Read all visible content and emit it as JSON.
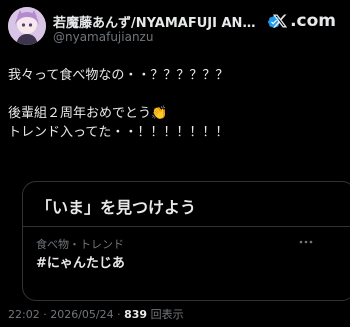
{
  "header": {
    "display_name": "若魔藤あんず/NYAMAFUJI ANZU...",
    "handle": "@nyamafujianzu",
    "brand_label": ".com",
    "verified_color": "#1d9bf0"
  },
  "tweet": {
    "line1": "我々って食べ物なの・・？？？？？？",
    "line2": "後輩組２周年おめでとう👏",
    "line3": "トレンド入ってた・・！！！！！！！"
  },
  "card": {
    "title": "「いま」を見つけよう",
    "trend_meta": "食べ物・トレンド",
    "trend_name": "#にゃんたじあ"
  },
  "footer": {
    "time": "22:02",
    "separator": "·",
    "date": "2026/05/24",
    "views_count": "839",
    "views_label": "回表示"
  }
}
